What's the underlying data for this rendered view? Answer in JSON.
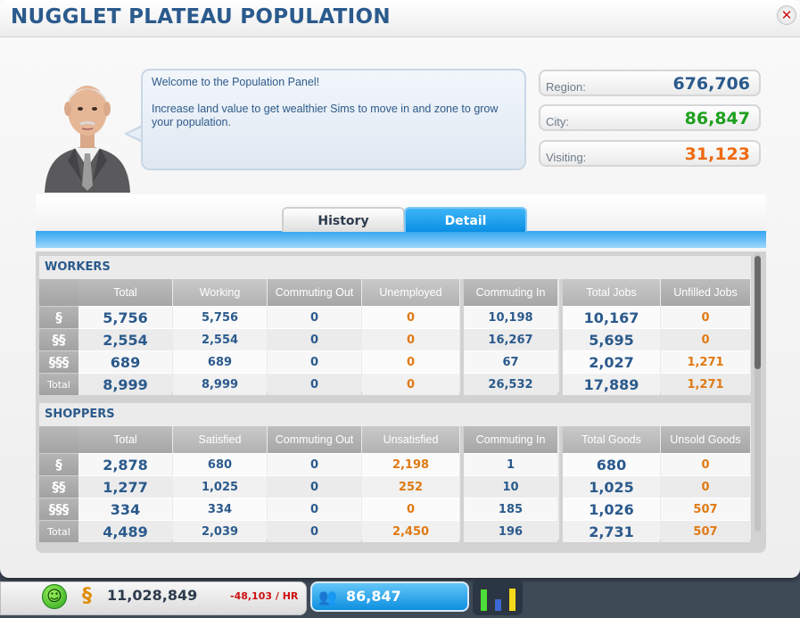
{
  "window": {
    "title": "NUGGLET PLATEAU POPULATION",
    "close_icon": "close-icon"
  },
  "advisor": {
    "welcome": "Welcome to the Population Panel!",
    "tip": "Increase land value to get wealthier Sims to move in and zone to grow your population."
  },
  "stats": [
    {
      "label": "Region:",
      "value": "676,706",
      "color": "#2b5a8c"
    },
    {
      "label": "City:",
      "value": "86,847",
      "color": "#1ea01e"
    },
    {
      "label": "Visiting:",
      "value": "31,123",
      "color": "#ee6a10"
    }
  ],
  "tabs": [
    {
      "label": "History",
      "active": false
    },
    {
      "label": "Detail",
      "active": true
    }
  ],
  "workers": {
    "title": "WORKERS",
    "headers": [
      "Total",
      "Working",
      "Commuting Out",
      "Unemployed",
      "Commuting In",
      "Total Jobs",
      "Unfilled Jobs"
    ],
    "row_labels": [
      "§",
      "§§",
      "§§§",
      "Total"
    ],
    "rows": [
      [
        "5,756",
        "5,756",
        "0",
        "0",
        "10,198",
        "10,167",
        "0"
      ],
      [
        "2,554",
        "2,554",
        "0",
        "0",
        "16,267",
        "5,695",
        "0"
      ],
      [
        "689",
        "689",
        "0",
        "0",
        "67",
        "2,027",
        "1,271"
      ],
      [
        "8,999",
        "8,999",
        "0",
        "0",
        "26,532",
        "17,889",
        "1,271"
      ]
    ]
  },
  "shoppers": {
    "title": "SHOPPERS",
    "headers": [
      "Total",
      "Satisfied",
      "Commuting Out",
      "Unsatisfied",
      "Commuting In",
      "Total Goods",
      "Unsold Goods"
    ],
    "row_labels": [
      "§",
      "§§",
      "§§§",
      "Total"
    ],
    "rows": [
      [
        "2,878",
        "680",
        "0",
        "2,198",
        "1",
        "680",
        "0"
      ],
      [
        "1,277",
        "1,025",
        "0",
        "252",
        "10",
        "1,025",
        "0"
      ],
      [
        "334",
        "334",
        "0",
        "0",
        "185",
        "1,026",
        "507"
      ],
      [
        "4,489",
        "2,039",
        "0",
        "2,450",
        "196",
        "2,731",
        "507"
      ]
    ]
  },
  "bottombar": {
    "happiness_icon": "smiley-icon",
    "currency_icon": "simoleon-icon",
    "funds": "11,028,849",
    "rate": "-48,103 / HR",
    "population_icon": "people-icon",
    "population": "86,847"
  },
  "rci_colors": [
    "#4ddd3a",
    "#3c68d8",
    "#f2d91c"
  ],
  "rci_levels": [
    0.85,
    0.5,
    0.9
  ],
  "colors": {
    "orange": "#e07a14",
    "blue": "#2b5a8c",
    "red": "#cc1111"
  }
}
